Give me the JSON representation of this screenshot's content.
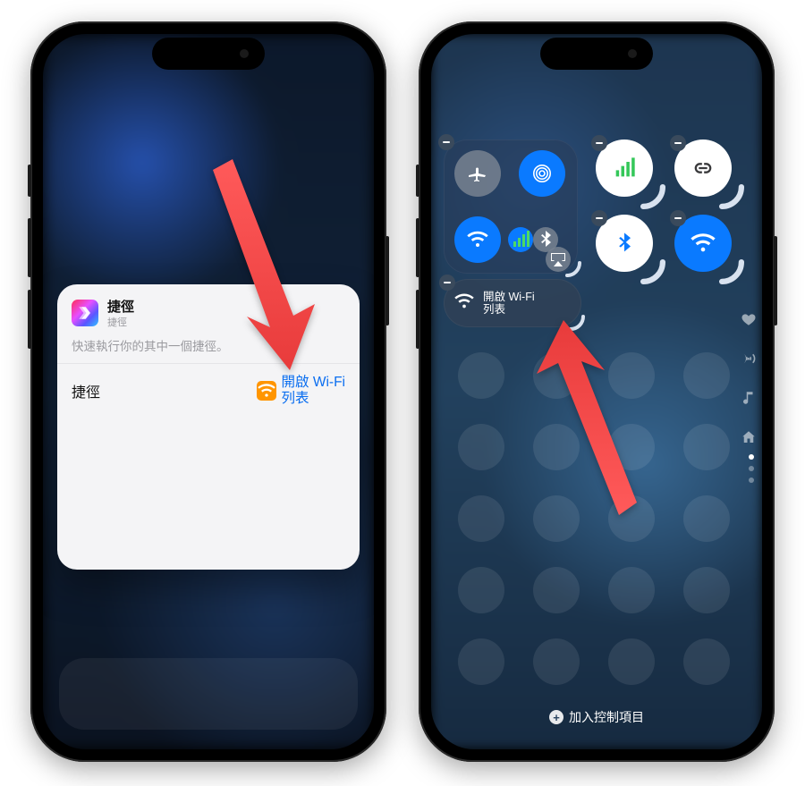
{
  "left": {
    "app_title": "捷徑",
    "app_subtitle": "捷徑",
    "card_subtitle": "快速執行你的其中一個捷徑。",
    "row_label": "捷徑",
    "row_action_line1": "開啟 Wi-Fi",
    "row_action_line2": "列表"
  },
  "right": {
    "shortcut_line1": "開啟 Wi-Fi",
    "shortcut_line2": "列表",
    "add_controls": "加入控制項目"
  }
}
